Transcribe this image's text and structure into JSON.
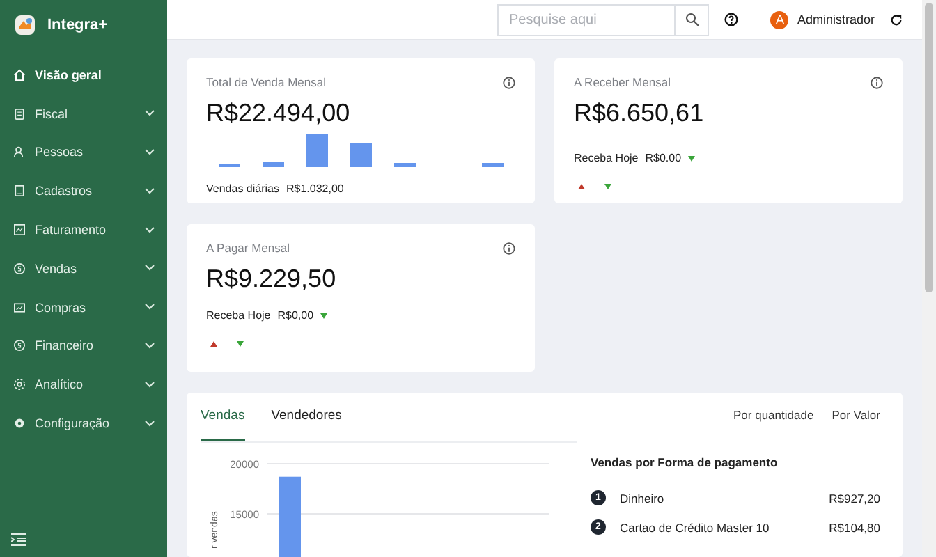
{
  "sidebar": {
    "brand": "Integra+",
    "items": [
      {
        "label": "Visão geral",
        "selected": true,
        "expandable": false
      },
      {
        "label": "Fiscal",
        "selected": false,
        "expandable": true
      },
      {
        "label": "Pessoas",
        "selected": false,
        "expandable": true
      },
      {
        "label": "Cadastros",
        "selected": false,
        "expandable": true
      },
      {
        "label": "Faturamento",
        "selected": false,
        "expandable": true
      },
      {
        "label": "Vendas",
        "selected": false,
        "expandable": true
      },
      {
        "label": "Compras",
        "selected": false,
        "expandable": true
      },
      {
        "label": "Financeiro",
        "selected": false,
        "expandable": true
      },
      {
        "label": "Analítico",
        "selected": false,
        "expandable": true
      },
      {
        "label": "Configuração",
        "selected": false,
        "expandable": true
      }
    ]
  },
  "topbar": {
    "search": {
      "placeholder": "Pesquise aqui"
    },
    "user": {
      "initial": "A",
      "name": "Administrador"
    }
  },
  "cards": [
    {
      "kind": "sales",
      "title": "Total de Venda Mensal",
      "value": "R$22.494,00",
      "footer_label": "Vendas diárias",
      "footer_value": "R$1.032,00"
    },
    {
      "kind": "balance",
      "title": "A Receber Mensal",
      "value": "R$6.650,61",
      "footer_label": "Receba Hoje",
      "footer_value": "R$0.00"
    },
    {
      "kind": "balance",
      "title": "A Pagar Mensal",
      "value": "R$9.229,50",
      "footer_label": "Receba Hoje",
      "footer_value": "R$0,00"
    }
  ],
  "sales_panel": {
    "tabs": [
      {
        "label": "Vendas",
        "selected": true
      },
      {
        "label": "Vendedores",
        "selected": false
      }
    ],
    "modes": [
      "Por quantidade",
      "Por Valor"
    ],
    "chart_data": {
      "type": "bar",
      "ylabel": "r vendas",
      "values": [
        18700
      ],
      "ylim": [
        0,
        20000
      ],
      "yticks": [
        15000,
        20000
      ]
    },
    "payments": {
      "title": "Vendas por Forma de pagamento",
      "items": [
        {
          "rank": "1",
          "name": "Dinheiro",
          "amount": "R$927,20"
        },
        {
          "rank": "2",
          "name": "Cartao de Crédito Master 10",
          "amount": "R$104,80"
        }
      ]
    }
  }
}
